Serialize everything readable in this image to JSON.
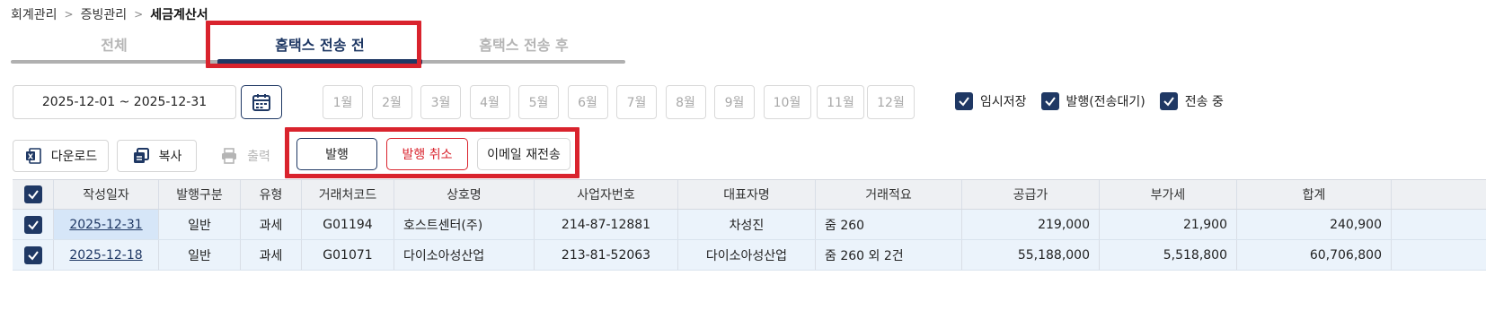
{
  "breadcrumb": {
    "items": [
      "회계관리",
      "증빙관리"
    ],
    "current": "세금계산서"
  },
  "tabs": [
    {
      "label": "전체",
      "active": false
    },
    {
      "label": "홈택스 전송 전",
      "active": true
    },
    {
      "label": "홈택스 전송 후",
      "active": false
    }
  ],
  "filter": {
    "date_range": "2025-12-01 ~ 2025-12-31",
    "months": [
      "1월",
      "2월",
      "3월",
      "4월",
      "5월",
      "6월",
      "7월",
      "8월",
      "9월",
      "10월",
      "11월",
      "12월"
    ],
    "status_checks": [
      {
        "label": "임시저장",
        "checked": true
      },
      {
        "label": "발행(전송대기)",
        "checked": true
      },
      {
        "label": "전송 중",
        "checked": true
      }
    ]
  },
  "toolbar": {
    "download_label": "다운로드",
    "copy_label": "복사",
    "print_label": "출력",
    "issue_label": "발행",
    "cancel_issue_label": "발행 취소",
    "resend_email_label": "이메일 재전송"
  },
  "table": {
    "columns": [
      "작성일자",
      "발행구분",
      "유형",
      "거래처코드",
      "상호명",
      "사업자번호",
      "대표자명",
      "거래적요",
      "공급가",
      "부가세",
      "합계"
    ],
    "rows": [
      {
        "checked": true,
        "date": "2025-12-31",
        "issue_type": "일반",
        "tax_type": "과세",
        "client_code": "G01194",
        "company": "호스트센터(주)",
        "biz_no": "214-87-12881",
        "ceo": "차성진",
        "summary": "줌 260",
        "supply": "219,000",
        "vat": "21,900",
        "total": "240,900"
      },
      {
        "checked": true,
        "date": "2025-12-18",
        "issue_type": "일반",
        "tax_type": "과세",
        "client_code": "G01071",
        "company": "다이소아성산업",
        "biz_no": "213-81-52063",
        "ceo": "다이소아성산업",
        "summary": "줌 260 외 2건",
        "supply": "55,188,000",
        "vat": "5,518,800",
        "total": "60,706,800"
      }
    ]
  },
  "colors": {
    "primary": "#1f3864",
    "highlight": "#d9232d",
    "cancel": "#d9232d"
  }
}
